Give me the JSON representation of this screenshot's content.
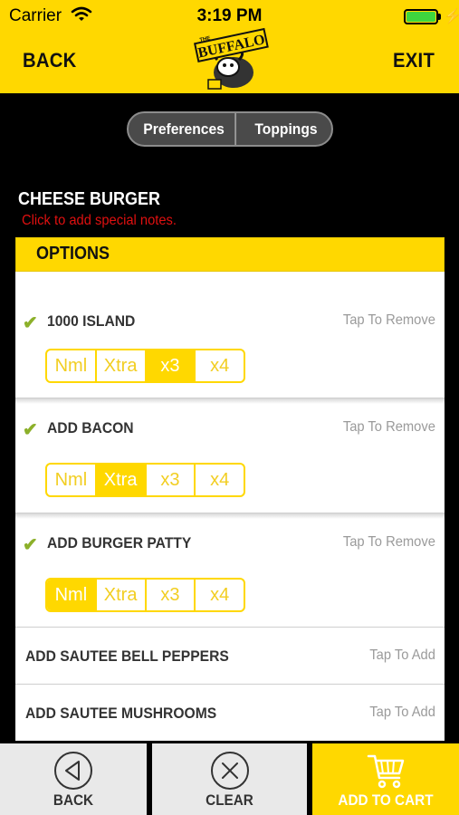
{
  "status_bar": {
    "carrier": "Carrier",
    "time": "3:19 PM"
  },
  "nav": {
    "back": "BACK",
    "exit": "EXIT",
    "logo_text": "BUFFALO",
    "logo_small": "THE"
  },
  "tabs": [
    {
      "label": "Preferences"
    },
    {
      "label": "Toppings"
    }
  ],
  "item": {
    "title": "CHEESE BURGER",
    "notes_hint": "Click to add special notes."
  },
  "options": {
    "header": "OPTIONS",
    "quantity_levels": [
      "Nml",
      "Xtra",
      "x3",
      "x4"
    ],
    "rows": [
      {
        "name": "1000 ISLAND",
        "action": "Tap To Remove",
        "selected": true,
        "level": "x3"
      },
      {
        "name": "ADD BACON",
        "action": "Tap To Remove",
        "selected": true,
        "level": "Xtra"
      },
      {
        "name": "ADD BURGER PATTY",
        "action": "Tap To Remove",
        "selected": true,
        "level": "Nml"
      },
      {
        "name": "ADD SAUTEE BELL PEPPERS",
        "action": "Tap To Add",
        "selected": false
      },
      {
        "name": "ADD SAUTEE MUSHROOMS",
        "action": "Tap To Add",
        "selected": false
      }
    ]
  },
  "bottom_bar": {
    "back": "BACK",
    "clear": "CLEAR",
    "add_to_cart": "ADD TO CART"
  },
  "colors": {
    "accent": "#FFD800",
    "check": "#8CB02A",
    "notes": "#E01010",
    "battery": "#3ED63E"
  }
}
